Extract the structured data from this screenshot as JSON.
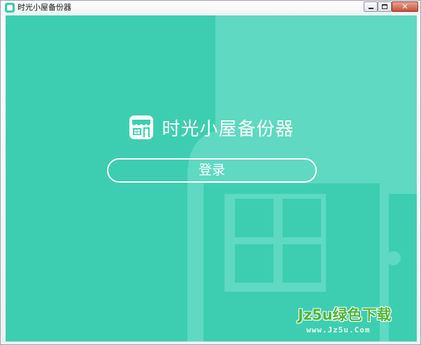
{
  "window": {
    "title": "时光小屋备份器",
    "controls": {
      "minimize_icon": "minimize-icon",
      "maximize_icon": "maximize-icon",
      "close_icon": "close-icon",
      "close_glyph": "✕"
    }
  },
  "main": {
    "app_name": "时光小屋备份器",
    "logo_icon": "house-shop-icon",
    "login_label": "登录"
  },
  "watermark": {
    "main_text": "Jz5u绿色下载",
    "sub_text": "www.Jz5u.Com"
  },
  "colors": {
    "background": "#3dceb1",
    "accent_light": "#5fd9c1",
    "text": "#ffffff",
    "watermark_green": "#4fb63a"
  }
}
